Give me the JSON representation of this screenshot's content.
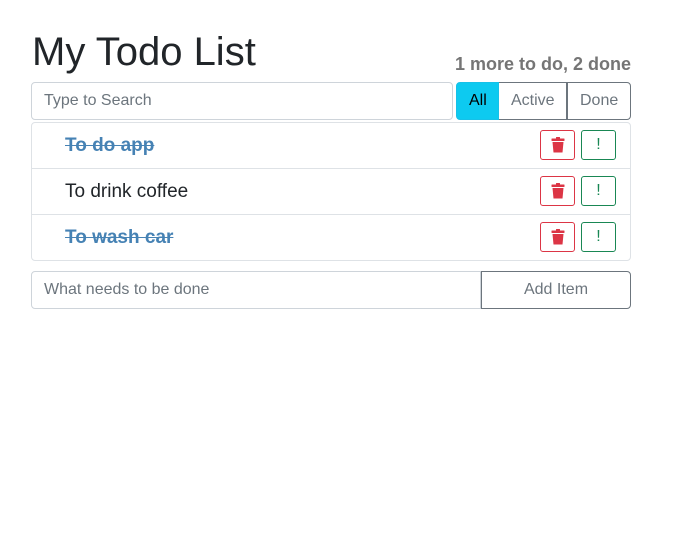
{
  "header": {
    "title": "My Todo List",
    "summary": "1 more to do, 2 done"
  },
  "search": {
    "placeholder": "Type to Search"
  },
  "filters": {
    "all": "All",
    "active": "Active",
    "done": "Done",
    "selected": "All"
  },
  "todos": [
    {
      "label": "To do app",
      "done": true
    },
    {
      "label": "To drink coffee",
      "done": false
    },
    {
      "label": "To wash car",
      "done": true
    }
  ],
  "item_actions": {
    "delete_icon": "trash-icon",
    "important_label": "!"
  },
  "add_form": {
    "placeholder": "What needs to be done",
    "button_label": "Add Item"
  },
  "colors": {
    "done_text": "#4682b4",
    "delete": "#dc3545",
    "important": "#198754",
    "filter_selected": "#0dcaf0",
    "summary": "#757575"
  }
}
